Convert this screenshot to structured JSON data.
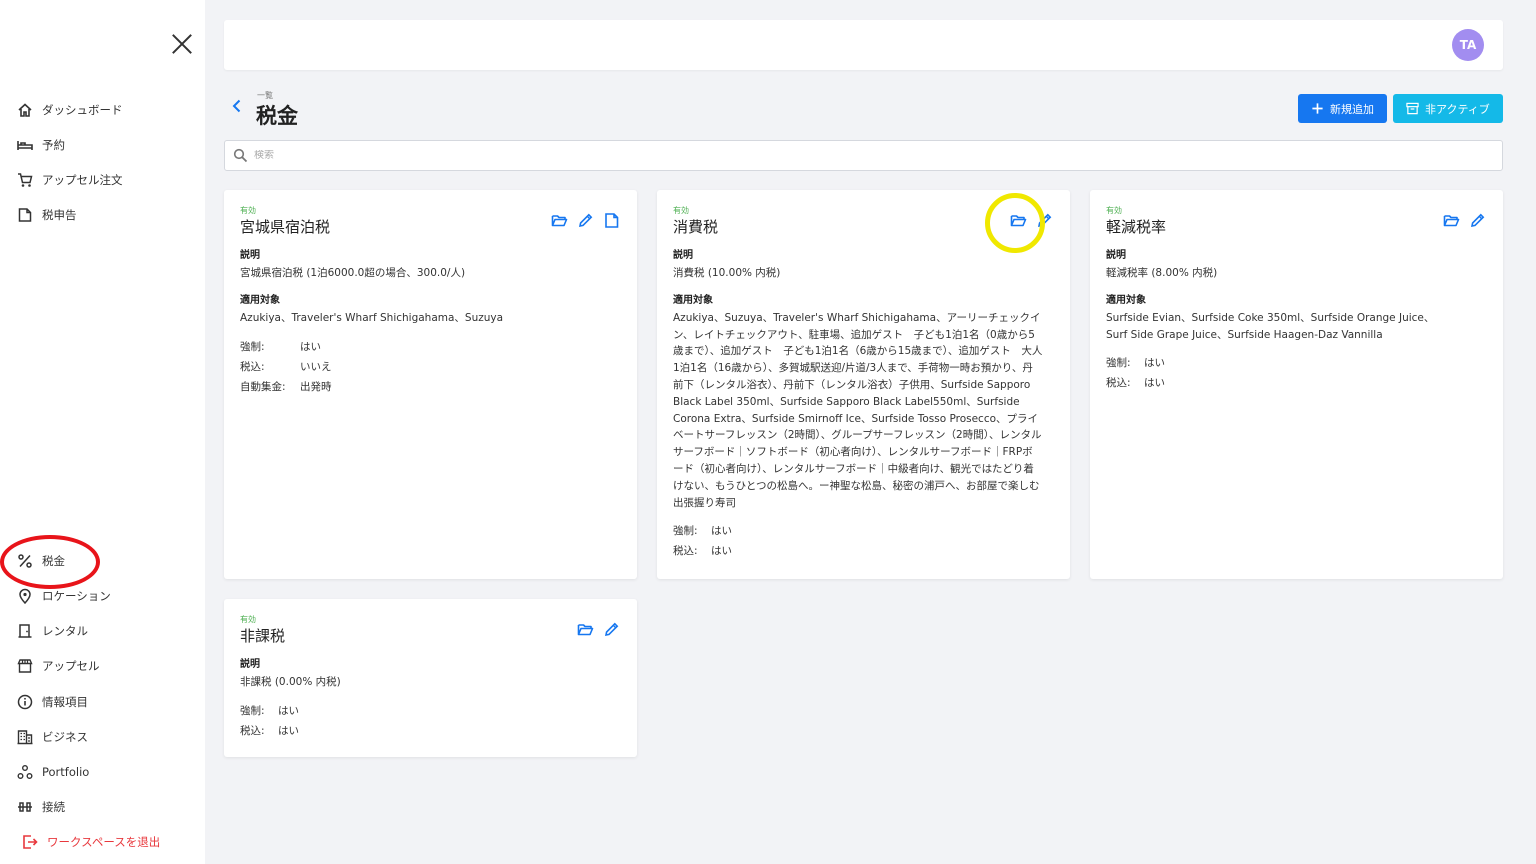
{
  "sidebar": {
    "nav": [
      {
        "label": "ダッシュボード",
        "icon": "home-icon"
      },
      {
        "label": "予約",
        "icon": "bed-icon"
      },
      {
        "label": "アップセル注文",
        "icon": "cart-icon"
      },
      {
        "label": "税申告",
        "icon": "document-icon"
      }
    ],
    "bottom_nav": [
      {
        "label": "税金",
        "icon": "percent-icon"
      },
      {
        "label": "ロケーション",
        "icon": "location-pin-icon"
      },
      {
        "label": "レンタル",
        "icon": "door-icon"
      },
      {
        "label": "アップセル",
        "icon": "store-icon"
      },
      {
        "label": "情報項目",
        "icon": "info-icon"
      },
      {
        "label": "ビジネス",
        "icon": "building-icon"
      },
      {
        "label": "Portfolio",
        "icon": "portfolio-icon"
      },
      {
        "label": "接続",
        "icon": "connection-icon"
      }
    ],
    "logout": {
      "label": "ワークスペースを退出",
      "icon": "logout-icon"
    }
  },
  "header": {
    "avatar_initials": "TA"
  },
  "page": {
    "breadcrumb": "一覧",
    "title": "税金",
    "new_button": "新規追加",
    "inactive_button": "非アクティブ"
  },
  "search": {
    "placeholder": "検索"
  },
  "cards": [
    {
      "status": "有効",
      "title": "宮城県宿泊税",
      "desc_label": "説明",
      "description": "宮城県宿泊税 (1泊6000.0超の場合、300.0/人)",
      "applies_label": "適用対象",
      "applies_to": "Azukiya、Traveler's Wharf Shichigahama、Suzuya",
      "mandatory_label": "強制:",
      "mandatory": "はい",
      "inclusive_label": "税込:",
      "inclusive": "いいえ",
      "autocollect_label": "自動集金:",
      "autocollect": "出発時"
    },
    {
      "status": "有効",
      "title": "消費税",
      "desc_label": "説明",
      "description": "消費税 (10.00% 内税)",
      "applies_label": "適用対象",
      "applies_to": "Azukiya、Suzuya、Traveler's Wharf Shichigahama、アーリーチェックイン、レイトチェックアウト、駐車場、追加ゲスト　子ども1泊1名（0歳から5歳まで）、追加ゲスト　子ども1泊1名（6歳から15歳まで）、追加ゲスト　大人1泊1名（16歳から）、多賀城駅送迎/片道/3人まで、手荷物一時お預かり、丹前下（レンタル浴衣）、丹前下（レンタル浴衣）子供用、Surfside Sapporo Black Label 350ml、Surfside Sapporo Black Label550ml、Surfside Corona Extra、Surfside Smirnoff Ice、Surfside Tosso Prosecco、プライベートサーフレッスン（2時間）、グループサーフレッスン（2時間）、レンタルサーフボード｜ソフトボード（初心者向け）、レンタルサーフボード｜FRPボード（初心者向け）、レンタルサーフボード｜中級者向け、観光ではたどり着けない、もうひとつの松島へ。ー神聖な松島、秘密の浦戸へ、お部屋で楽しむ 出張握り寿司",
      "mandatory_label": "強制:",
      "mandatory": "はい",
      "inclusive_label": "税込:",
      "inclusive": "はい"
    },
    {
      "status": "有効",
      "title": "軽減税率",
      "desc_label": "説明",
      "description": "軽減税率 (8.00% 内税)",
      "applies_label": "適用対象",
      "applies_to": "Surfside Evian、Surfside Coke 350ml、Surfside Orange Juice、Surf Side Grape Juice、Surfside Haagen-Daz Vannilla",
      "mandatory_label": "強制:",
      "mandatory": "はい",
      "inclusive_label": "税込:",
      "inclusive": "はい"
    },
    {
      "status": "有効",
      "title": "非課税",
      "desc_label": "説明",
      "description": "非課税 (0.00% 内税)",
      "mandatory_label": "強制:",
      "mandatory": "はい",
      "inclusive_label": "税込:",
      "inclusive": "はい"
    }
  ],
  "colors": {
    "primary": "#1677f0",
    "secondary": "#14b9e8",
    "active_status": "#4caf50",
    "logout": "#e8383d",
    "red_annotation": "#e8141a",
    "yellow_annotation": "#f0e800"
  }
}
